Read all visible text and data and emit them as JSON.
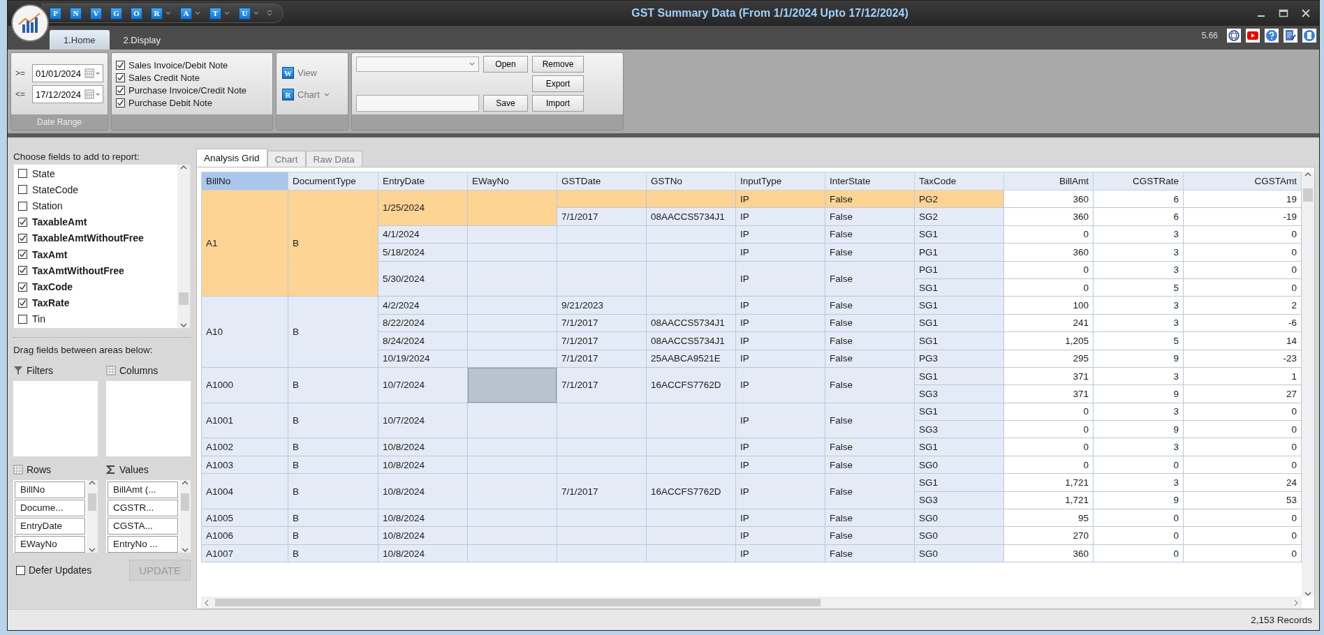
{
  "window": {
    "title": "GST Summary Data (From 1/1/2024 Upto 17/12/2024)"
  },
  "quick_access": [
    {
      "letter": "P",
      "dropdown": false
    },
    {
      "letter": "N",
      "dropdown": false
    },
    {
      "letter": "V",
      "dropdown": false
    },
    {
      "letter": "G",
      "dropdown": false
    },
    {
      "letter": "O",
      "dropdown": false
    },
    {
      "letter": "R",
      "dropdown": true
    },
    {
      "letter": "A",
      "dropdown": true
    },
    {
      "letter": "T",
      "dropdown": true
    },
    {
      "letter": "U",
      "dropdown": true
    }
  ],
  "ribbon_tabs": [
    {
      "label": "1.Home",
      "selected": true
    },
    {
      "label": "2.Display",
      "selected": false
    }
  ],
  "version": "5.66",
  "date_range": {
    "caption": "Date Range",
    "from": {
      "operator": ">=",
      "value": "01/01/2024"
    },
    "to": {
      "operator": "<=",
      "value": "17/12/2024"
    }
  },
  "document_filters": [
    {
      "label": "Sales Invoice/Debit Note",
      "checked": true
    },
    {
      "label": "Sales Credit Note",
      "checked": true
    },
    {
      "label": "Purchase Invoice/Credit Note",
      "checked": true
    },
    {
      "label": "Purchase Debit Note",
      "checked": true
    }
  ],
  "view_group": [
    {
      "icon_letter": "W",
      "label": "View",
      "dropdown": false
    },
    {
      "icon_letter": "R",
      "label": "Chart",
      "dropdown": true
    }
  ],
  "layout_group": {
    "buttons": [
      "Open",
      "Remove",
      "Export",
      "Save",
      "Import"
    ]
  },
  "field_list": {
    "heading": "Choose fields to add to report:",
    "fields": [
      {
        "label": "State",
        "checked": false
      },
      {
        "label": "StateCode",
        "checked": false
      },
      {
        "label": "Station",
        "checked": false
      },
      {
        "label": "TaxableAmt",
        "checked": true
      },
      {
        "label": "TaxableAmtWithoutFree",
        "checked": true
      },
      {
        "label": "TaxAmt",
        "checked": true
      },
      {
        "label": "TaxAmtWithoutFree",
        "checked": true
      },
      {
        "label": "TaxCode",
        "checked": true
      },
      {
        "label": "TaxRate",
        "checked": true
      },
      {
        "label": "Tin",
        "checked": false
      }
    ]
  },
  "drag_hint": "Drag fields between areas below:",
  "areas": {
    "filters": {
      "label": "Filters"
    },
    "columns": {
      "label": "Columns"
    },
    "rows": {
      "label": "Rows",
      "items": [
        "BillNo",
        "Docume...",
        "EntryDate",
        "EWayNo"
      ]
    },
    "values": {
      "label": "Values",
      "items": [
        "BillAmt (...",
        "CGSTR...",
        "CGSTA...",
        "EntryNo ..."
      ]
    }
  },
  "defer_updates": {
    "label": "Defer Updates",
    "checked": false
  },
  "update_button": {
    "label": "UPDATE",
    "disabled": true
  },
  "view_tabs": [
    {
      "label": "Analysis Grid",
      "selected": true
    },
    {
      "label": "Chart",
      "selected": false
    },
    {
      "label": "Raw Data",
      "selected": false
    }
  ],
  "grid": {
    "columns": [
      {
        "label": "BillNo",
        "selected": true
      },
      {
        "label": "DocumentType",
        "selected": false
      },
      {
        "label": "EntryDate",
        "selected": false
      },
      {
        "label": "EWayNo",
        "selected": false
      },
      {
        "label": "GSTDate",
        "selected": false
      },
      {
        "label": "GSTNo",
        "selected": false
      },
      {
        "label": "InputType",
        "selected": false
      },
      {
        "label": "InterState",
        "selected": false
      },
      {
        "label": "TaxCode",
        "selected": false
      },
      {
        "label": "BillAmt",
        "selected": false
      },
      {
        "label": "CGSTRate",
        "selected": false
      },
      {
        "label": "CGSTAmt",
        "selected": false
      }
    ],
    "bills": [
      {
        "bill_no": "A1",
        "document_type": "B",
        "selected": true,
        "entries": [
          {
            "entry_date": "1/25/2024",
            "selected": true,
            "eways": [
              {
                "selected": true,
                "focused": false,
                "gsts": [
                  {
                    "selected": true,
                    "input_type": "IP",
                    "inter_state": "False",
                    "taxes": [
                      {
                        "tax_code": "PG2",
                        "bill_amt": "360",
                        "cgst_rate": "6",
                        "cgst_amt": "19",
                        "selected": true
                      }
                    ]
                  },
                  {
                    "selected": false,
                    "gst_date": "7/1/2017",
                    "gst_no": "08AACCS5734J1",
                    "input_type": "IP",
                    "inter_state": "False",
                    "taxes": [
                      {
                        "tax_code": "SG2",
                        "bill_amt": "360",
                        "cgst_rate": "6",
                        "cgst_amt": "-19",
                        "selected": false
                      }
                    ]
                  }
                ]
              }
            ]
          },
          {
            "entry_date": "4/1/2024",
            "selected": false,
            "eways": [
              {
                "selected": false,
                "focused": false,
                "gsts": [
                  {
                    "selected": false,
                    "input_type": "IP",
                    "inter_state": "False",
                    "taxes": [
                      {
                        "tax_code": "SG1",
                        "bill_amt": "0",
                        "cgst_rate": "3",
                        "cgst_amt": "0",
                        "selected": false
                      }
                    ]
                  }
                ]
              }
            ]
          },
          {
            "entry_date": "5/18/2024",
            "selected": false,
            "eways": [
              {
                "selected": false,
                "focused": false,
                "gsts": [
                  {
                    "selected": false,
                    "input_type": "IP",
                    "inter_state": "False",
                    "taxes": [
                      {
                        "tax_code": "PG1",
                        "bill_amt": "360",
                        "cgst_rate": "3",
                        "cgst_amt": "0",
                        "selected": false
                      }
                    ]
                  }
                ]
              }
            ]
          },
          {
            "entry_date": "5/30/2024",
            "selected": false,
            "eways": [
              {
                "selected": false,
                "focused": false,
                "gsts": [
                  {
                    "selected": false,
                    "input_type": "IP",
                    "inter_state": "False",
                    "taxes": [
                      {
                        "tax_code": "PG1",
                        "bill_amt": "0",
                        "cgst_rate": "3",
                        "cgst_amt": "0",
                        "selected": false
                      },
                      {
                        "tax_code": "SG1",
                        "bill_amt": "0",
                        "cgst_rate": "5",
                        "cgst_amt": "0",
                        "selected": false
                      }
                    ]
                  }
                ]
              }
            ]
          }
        ]
      },
      {
        "bill_no": "A10",
        "document_type": "B",
        "selected": false,
        "entries": [
          {
            "entry_date": "4/2/2024",
            "selected": false,
            "eways": [
              {
                "selected": false,
                "focused": false,
                "gsts": [
                  {
                    "selected": false,
                    "gst_date": "9/21/2023",
                    "input_type": "IP",
                    "inter_state": "False",
                    "taxes": [
                      {
                        "tax_code": "SG1",
                        "bill_amt": "100",
                        "cgst_rate": "3",
                        "cgst_amt": "2",
                        "selected": false
                      }
                    ]
                  }
                ]
              }
            ]
          },
          {
            "entry_date": "8/22/2024",
            "selected": false,
            "eways": [
              {
                "selected": false,
                "focused": false,
                "gsts": [
                  {
                    "selected": false,
                    "gst_date": "7/1/2017",
                    "gst_no": "08AACCS5734J1",
                    "input_type": "IP",
                    "inter_state": "False",
                    "taxes": [
                      {
                        "tax_code": "SG1",
                        "bill_amt": "241",
                        "cgst_rate": "3",
                        "cgst_amt": "-6",
                        "selected": false
                      }
                    ]
                  }
                ]
              }
            ]
          },
          {
            "entry_date": "8/24/2024",
            "selected": false,
            "eways": [
              {
                "selected": false,
                "focused": false,
                "gsts": [
                  {
                    "selected": false,
                    "gst_date": "7/1/2017",
                    "gst_no": "08AACCS5734J1",
                    "input_type": "IP",
                    "inter_state": "False",
                    "taxes": [
                      {
                        "tax_code": "SG1",
                        "bill_amt": "1,205",
                        "cgst_rate": "5",
                        "cgst_amt": "14",
                        "selected": false
                      }
                    ]
                  }
                ]
              }
            ]
          },
          {
            "entry_date": "10/19/2024",
            "selected": false,
            "eways": [
              {
                "selected": false,
                "focused": false,
                "gsts": [
                  {
                    "selected": false,
                    "gst_date": "7/1/2017",
                    "gst_no": "25AABCA9521E",
                    "input_type": "IP",
                    "inter_state": "False",
                    "taxes": [
                      {
                        "tax_code": "PG3",
                        "bill_amt": "295",
                        "cgst_rate": "9",
                        "cgst_amt": "-23",
                        "selected": false
                      }
                    ]
                  }
                ]
              }
            ]
          }
        ]
      },
      {
        "bill_no": "A1000",
        "document_type": "B",
        "selected": false,
        "entries": [
          {
            "entry_date": "10/7/2024",
            "selected": false,
            "eways": [
              {
                "selected": false,
                "focused": true,
                "gsts": [
                  {
                    "selected": false,
                    "gst_date": "7/1/2017",
                    "gst_no": "16ACCFS7762D",
                    "input_type": "IP",
                    "inter_state": "False",
                    "taxes": [
                      {
                        "tax_code": "SG1",
                        "bill_amt": "371",
                        "cgst_rate": "3",
                        "cgst_amt": "1",
                        "selected": false
                      },
                      {
                        "tax_code": "SG3",
                        "bill_amt": "371",
                        "cgst_rate": "9",
                        "cgst_amt": "27",
                        "selected": false
                      }
                    ]
                  }
                ]
              }
            ]
          }
        ]
      },
      {
        "bill_no": "A1001",
        "document_type": "B",
        "selected": false,
        "entries": [
          {
            "entry_date": "10/7/2024",
            "selected": false,
            "eways": [
              {
                "selected": false,
                "focused": false,
                "gsts": [
                  {
                    "selected": false,
                    "input_type": "IP",
                    "inter_state": "False",
                    "taxes": [
                      {
                        "tax_code": "SG1",
                        "bill_amt": "0",
                        "cgst_rate": "3",
                        "cgst_amt": "0",
                        "selected": false
                      },
                      {
                        "tax_code": "SG3",
                        "bill_amt": "0",
                        "cgst_rate": "9",
                        "cgst_amt": "0",
                        "selected": false
                      }
                    ]
                  }
                ]
              }
            ]
          }
        ]
      },
      {
        "bill_no": "A1002",
        "document_type": "B",
        "selected": false,
        "entries": [
          {
            "entry_date": "10/8/2024",
            "selected": false,
            "eways": [
              {
                "selected": false,
                "focused": false,
                "gsts": [
                  {
                    "selected": false,
                    "input_type": "IP",
                    "inter_state": "False",
                    "taxes": [
                      {
                        "tax_code": "SG1",
                        "bill_amt": "0",
                        "cgst_rate": "3",
                        "cgst_amt": "0",
                        "selected": false
                      }
                    ]
                  }
                ]
              }
            ]
          }
        ]
      },
      {
        "bill_no": "A1003",
        "document_type": "B",
        "selected": false,
        "entries": [
          {
            "entry_date": "10/8/2024",
            "selected": false,
            "eways": [
              {
                "selected": false,
                "focused": false,
                "gsts": [
                  {
                    "selected": false,
                    "input_type": "IP",
                    "inter_state": "False",
                    "taxes": [
                      {
                        "tax_code": "SG0",
                        "bill_amt": "0",
                        "cgst_rate": "0",
                        "cgst_amt": "0",
                        "selected": false
                      }
                    ]
                  }
                ]
              }
            ]
          }
        ]
      },
      {
        "bill_no": "A1004",
        "document_type": "B",
        "selected": false,
        "entries": [
          {
            "entry_date": "10/8/2024",
            "selected": false,
            "eways": [
              {
                "selected": false,
                "focused": false,
                "gsts": [
                  {
                    "selected": false,
                    "gst_date": "7/1/2017",
                    "gst_no": "16ACCFS7762D",
                    "input_type": "IP",
                    "inter_state": "False",
                    "taxes": [
                      {
                        "tax_code": "SG1",
                        "bill_amt": "1,721",
                        "cgst_rate": "3",
                        "cgst_amt": "24",
                        "selected": false
                      },
                      {
                        "tax_code": "SG3",
                        "bill_amt": "1,721",
                        "cgst_rate": "9",
                        "cgst_amt": "53",
                        "selected": false
                      }
                    ]
                  }
                ]
              }
            ]
          }
        ]
      },
      {
        "bill_no": "A1005",
        "document_type": "B",
        "selected": false,
        "entries": [
          {
            "entry_date": "10/8/2024",
            "selected": false,
            "eways": [
              {
                "selected": false,
                "focused": false,
                "gsts": [
                  {
                    "selected": false,
                    "input_type": "IP",
                    "inter_state": "False",
                    "taxes": [
                      {
                        "tax_code": "SG0",
                        "bill_amt": "95",
                        "cgst_rate": "0",
                        "cgst_amt": "0",
                        "selected": false
                      }
                    ]
                  }
                ]
              }
            ]
          }
        ]
      },
      {
        "bill_no": "A1006",
        "document_type": "B",
        "selected": false,
        "entries": [
          {
            "entry_date": "10/8/2024",
            "selected": false,
            "eways": [
              {
                "selected": false,
                "focused": false,
                "gsts": [
                  {
                    "selected": false,
                    "input_type": "IP",
                    "inter_state": "False",
                    "taxes": [
                      {
                        "tax_code": "SG0",
                        "bill_amt": "270",
                        "cgst_rate": "0",
                        "cgst_amt": "0",
                        "selected": false
                      }
                    ]
                  }
                ]
              }
            ]
          }
        ]
      },
      {
        "bill_no": "A1007",
        "document_type": "B",
        "selected": false,
        "entries": [
          {
            "entry_date": "10/8/2024",
            "selected": false,
            "eways": [
              {
                "selected": false,
                "focused": false,
                "gsts": [
                  {
                    "selected": false,
                    "input_type": "IP",
                    "inter_state": "False",
                    "taxes": [
                      {
                        "tax_code": "SG0",
                        "bill_amt": "360",
                        "cgst_rate": "0",
                        "cgst_amt": "0",
                        "selected": false
                      }
                    ]
                  }
                ]
              }
            ]
          }
        ]
      }
    ]
  },
  "status_bar": {
    "records": "2,153 Records"
  }
}
